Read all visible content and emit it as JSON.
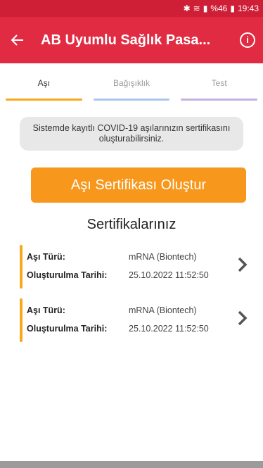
{
  "status": {
    "percent": "%46",
    "time": "19:43"
  },
  "header": {
    "title": "AB Uyumlu Sağlık Pasa...",
    "back_icon": "arrow-left-icon",
    "info_icon": "info-icon",
    "info_glyph": "i"
  },
  "tabs": [
    {
      "label": "Aşı",
      "color": "#f7a81b"
    },
    {
      "label": "Bağışıklık",
      "color": "#a9c7ee"
    },
    {
      "label": "Test",
      "color": "#c3b3e0"
    }
  ],
  "notice": "Sistemde kayıtlı COVID-19 aşılarınızın sertifikasını oluşturabilirsiniz.",
  "create_button": "Aşı Sertifikası Oluştur",
  "section_title": "Sertifikalarınız",
  "certificates": [
    {
      "type_label": "Aşı Türü:",
      "type_value": "mRNA (Biontech)",
      "date_label": "Oluşturulma Tarihi:",
      "date_value": "25.10.2022 11:52:50"
    },
    {
      "type_label": "Aşı Türü:",
      "type_value": "mRNA (Biontech)",
      "date_label": "Oluşturulma Tarihi:",
      "date_value": "25.10.2022 11:52:50"
    }
  ],
  "colors": {
    "header": "#e12b42",
    "accent_orange": "#f7971c"
  }
}
